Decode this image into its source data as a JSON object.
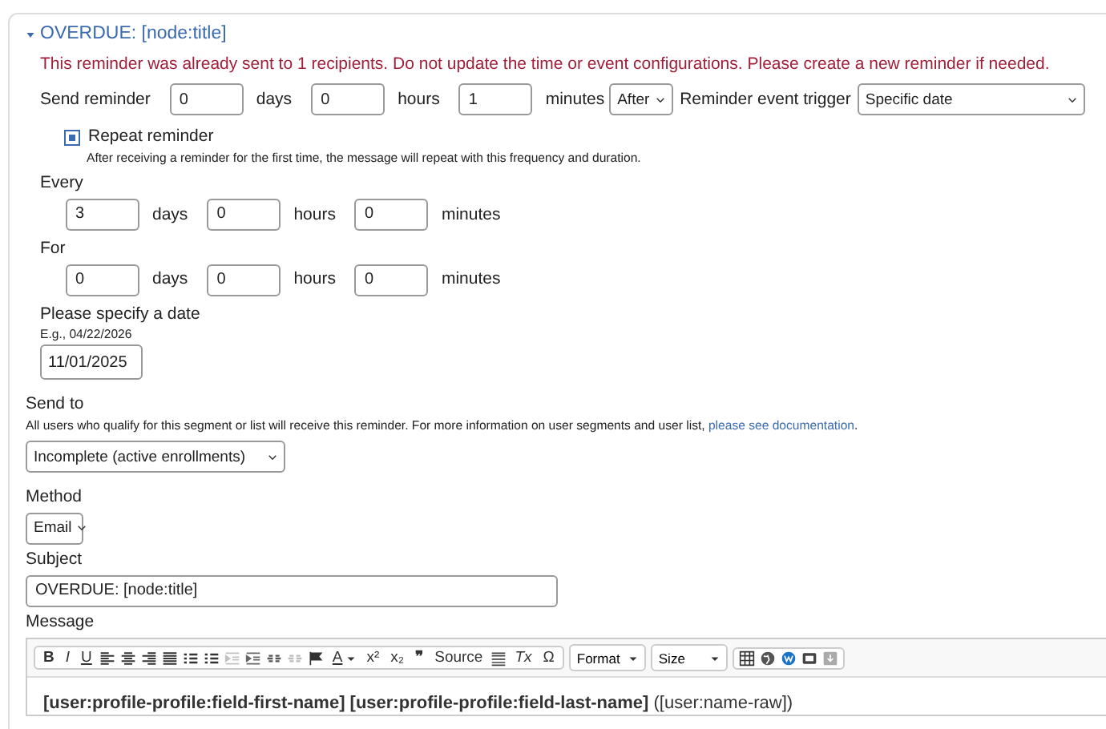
{
  "section": {
    "title": "OVERDUE: [node:title]",
    "expanded": true,
    "warning": "This reminder was already sent to 1 recipients. Do not update the time or event configurations. Please create a new reminder if needed."
  },
  "send_reminder": {
    "label": "Send reminder",
    "fields": [
      {
        "value": "0",
        "unit": "days"
      },
      {
        "value": "0",
        "unit": "hours"
      },
      {
        "value": "1",
        "unit": "minutes"
      }
    ],
    "timing": "After",
    "trigger_label": "Reminder event trigger",
    "trigger": "Specific date"
  },
  "repeat": {
    "label": "Repeat reminder",
    "checked": true,
    "help": "After receiving a reminder for the first time, the message will repeat with this frequency and duration."
  },
  "every": {
    "label": "Every",
    "fields": [
      {
        "value": "3",
        "unit": "days"
      },
      {
        "value": "0",
        "unit": "hours"
      },
      {
        "value": "0",
        "unit": "minutes"
      }
    ]
  },
  "for": {
    "label": "For",
    "fields": [
      {
        "value": "0",
        "unit": "days"
      },
      {
        "value": "0",
        "unit": "hours"
      },
      {
        "value": "0",
        "unit": "minutes"
      }
    ]
  },
  "date": {
    "label": "Please specify a date",
    "hint": "E.g., 04/22/2026",
    "value": "11/01/2025"
  },
  "send_to": {
    "label": "Send to",
    "help": "All users who qualify for this segment or list will receive this reminder. For more information on user segments and user list, ",
    "link": "please see documentation",
    "help_end": ".",
    "value": "Incomplete (active enrollments)"
  },
  "method": {
    "label": "Method",
    "value": "Email"
  },
  "subject": {
    "label": "Subject",
    "value": "OVERDUE: [node:title]"
  },
  "message": {
    "label": "Message",
    "toolbar": [
      "B",
      "I",
      "U",
      "A",
      "x²",
      "x₂",
      "❞",
      "Source",
      "Tx",
      "Ω",
      "Format",
      "Size"
    ],
    "body": "**[user:profile-profile:field-first-name] [user:profile-profile:field-last-name]** ([user:name-raw])"
  }
}
